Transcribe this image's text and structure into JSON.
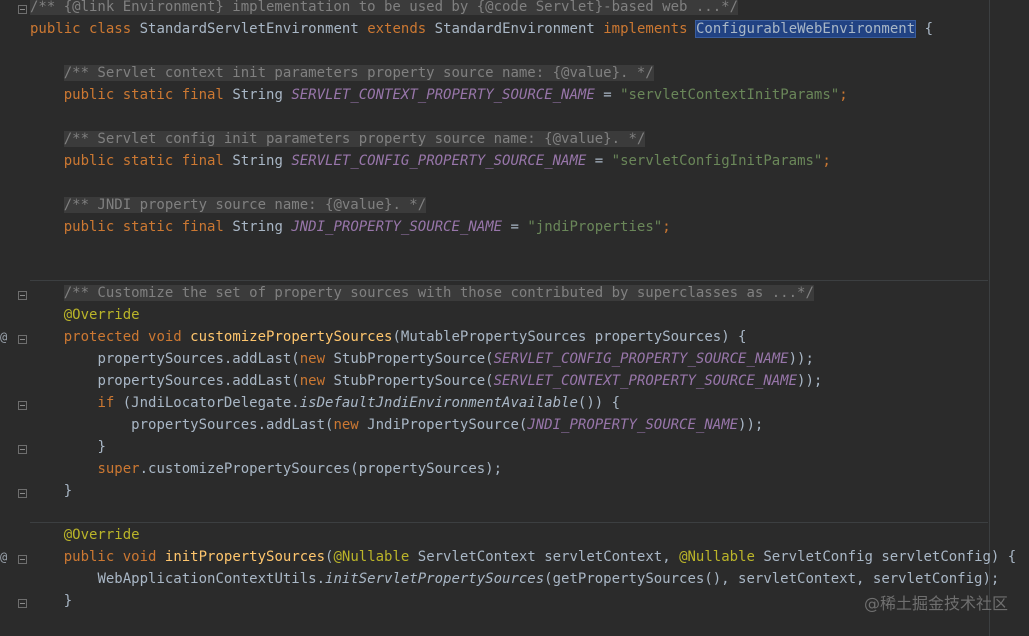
{
  "editor": {
    "lines": {
      "l1": {
        "doc_open": "/** {@link Environment} implementation to be used by {@code Servlet}-based web ...*/"
      },
      "l2": {
        "kw_public": "public",
        "kw_class": "class",
        "class_name": "StandardServletEnvironment",
        "kw_extends": "extends",
        "super_name": "StandardEnvironment",
        "kw_implements": "implements",
        "iface_name": "ConfigurableWebEnvironment",
        "brace": " {"
      },
      "l4": {
        "comment": "/** Servlet context init parameters property source name: {@value}. */"
      },
      "l5": {
        "mods": "public static final",
        "type": "String",
        "const": "SERVLET_CONTEXT_PROPERTY_SOURCE_NAME",
        "eq": " = ",
        "value": "\"servletContextInitParams\"",
        "semi": ";"
      },
      "l7": {
        "comment": "/** Servlet config init parameters property source name: {@value}. */"
      },
      "l8": {
        "mods": "public static final",
        "type": "String",
        "const": "SERVLET_CONFIG_PROPERTY_SOURCE_NAME",
        "eq": " = ",
        "value": "\"servletConfigInitParams\"",
        "semi": ";"
      },
      "l10": {
        "comment": "/** JNDI property source name: {@value}. */"
      },
      "l11": {
        "mods": "public static final",
        "type": "String",
        "const": "JNDI_PROPERTY_SOURCE_NAME",
        "eq": " = ",
        "value": "\"jndiProperties\"",
        "semi": ";"
      },
      "l14": {
        "comment": "/** Customize the set of property sources with those contributed by superclasses as ...*/"
      },
      "l15": {
        "annotation": "@Override"
      },
      "l16": {
        "kw_protected": "protected",
        "kw_void": "void",
        "method": "customizePropertySources",
        "params": "(MutablePropertySources propertySources) {"
      },
      "l17": {
        "pre": "propertySources.addLast(",
        "kw_new": "new",
        "call": " StubPropertySource(",
        "const": "SERVLET_CONFIG_PROPERTY_SOURCE_NAME",
        "post": "));"
      },
      "l18": {
        "pre": "propertySources.addLast(",
        "kw_new": "new",
        "call": " StubPropertySource(",
        "const": "SERVLET_CONTEXT_PROPERTY_SOURCE_NAME",
        "post": "));"
      },
      "l19": {
        "kw_if": "if",
        "pre": " (JndiLocatorDelegate.",
        "static_call": "isDefaultJndiEnvironmentAvailable",
        "post": "()) {"
      },
      "l20": {
        "pre": "propertySources.addLast(",
        "kw_new": "new",
        "call": " JndiPropertySource(",
        "const": "JNDI_PROPERTY_SOURCE_NAME",
        "post": "));"
      },
      "l21": {
        "text": "}"
      },
      "l22": {
        "kw_super": "super",
        "post": ".customizePropertySources(propertySources);"
      },
      "l23": {
        "text": "}"
      },
      "l25": {
        "annotation": "@Override"
      },
      "l26": {
        "kw_public": "public",
        "kw_void": "void",
        "method": "initPropertySources",
        "p1": "(",
        "ann1": "@Nullable",
        "p2": " ServletContext servletContext, ",
        "ann2": "@Nullable",
        "p3": " ServletConfig servletConfig) {"
      },
      "l27": {
        "pre": "WebApplicationContextUtils.",
        "static_call": "initServletPropertySources",
        "post": "(getPropertySources(), servletContext, servletConfig);"
      },
      "l28": {
        "text": "}"
      }
    },
    "gutter": {
      "override_marker": "@"
    }
  },
  "watermark": "@稀土掘金技术社区"
}
